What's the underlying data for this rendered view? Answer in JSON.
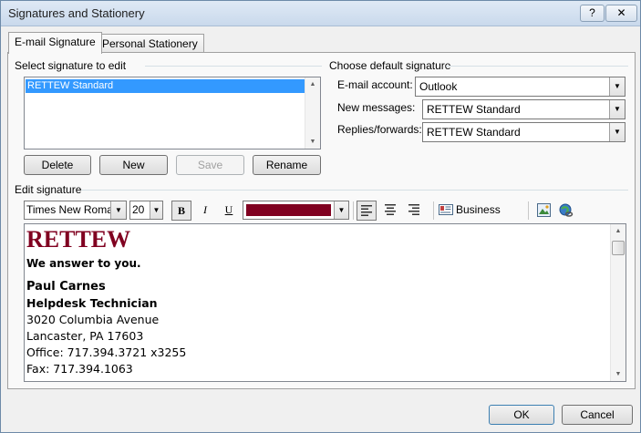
{
  "window": {
    "title": "Signatures and Stationery",
    "help_label": "?",
    "close_label": "✕"
  },
  "tabs": [
    {
      "label": "E-mail Signature",
      "active": true
    },
    {
      "label": "Personal Stationery",
      "active": false
    }
  ],
  "select_signature": {
    "label": "Select signature to edit",
    "items": [
      "RETTEW Standard"
    ],
    "selected": "RETTEW Standard"
  },
  "signature_buttons": {
    "delete": "Delete",
    "new": "New",
    "save": "Save",
    "rename": "Rename"
  },
  "default_signature": {
    "label": "Choose default signature",
    "email_account_label": "E-mail account:",
    "email_account_value": "Outlook",
    "new_messages_label": "New messages:",
    "new_messages_value": "RETTEW Standard",
    "replies_label": "Replies/forwards:",
    "replies_value": "RETTEW Standard"
  },
  "edit_signature": {
    "label": "Edit signature",
    "font_family": "Times New Roman",
    "font_size": "20",
    "bold_label": "B",
    "italic_label": "I",
    "underline_label": "U",
    "font_color": "#800020",
    "business_card_label": "Business Card",
    "content": {
      "company": "RETTEW",
      "tagline": "We answer to you.",
      "name": "Paul Carnes",
      "title": "Helpdesk Technician",
      "address1": "3020 Columbia Avenue",
      "address2": "Lancaster, PA 17603",
      "office": "Office: 717.394.3721 x3255",
      "fax": "Fax: 717.394.1063"
    }
  },
  "footer": {
    "ok": "OK",
    "cancel": "Cancel"
  }
}
